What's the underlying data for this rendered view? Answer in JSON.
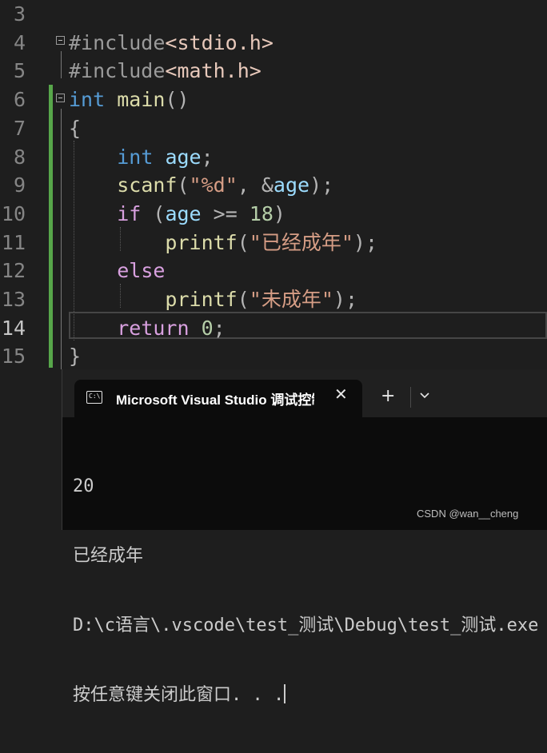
{
  "editor": {
    "lines": [
      {
        "no": "3",
        "tokens": []
      },
      {
        "no": "4",
        "tokens": [
          {
            "t": "#include",
            "c": "pre"
          },
          {
            "t": "<stdio.h>",
            "c": "inc"
          }
        ]
      },
      {
        "no": "5",
        "tokens": [
          {
            "t": "#include",
            "c": "pre"
          },
          {
            "t": "<math.h>",
            "c": "inc"
          }
        ]
      },
      {
        "no": "6",
        "tokens": [
          {
            "t": "int",
            "c": "kw"
          },
          {
            "t": " ",
            "c": ""
          },
          {
            "t": "main",
            "c": "fn"
          },
          {
            "t": "()",
            "c": "punct"
          }
        ]
      },
      {
        "no": "7",
        "tokens": [
          {
            "t": "{",
            "c": "punct"
          }
        ]
      },
      {
        "no": "8",
        "tokens": [
          {
            "t": "    ",
            "c": ""
          },
          {
            "t": "int",
            "c": "kw"
          },
          {
            "t": " ",
            "c": ""
          },
          {
            "t": "age",
            "c": "var"
          },
          {
            "t": ";",
            "c": "punct"
          }
        ]
      },
      {
        "no": "9",
        "tokens": [
          {
            "t": "    ",
            "c": ""
          },
          {
            "t": "scanf",
            "c": "fn"
          },
          {
            "t": "(",
            "c": "punct"
          },
          {
            "t": "\"%d\"",
            "c": "str"
          },
          {
            "t": ", &",
            "c": "punct"
          },
          {
            "t": "age",
            "c": "var"
          },
          {
            "t": ");",
            "c": "punct"
          }
        ]
      },
      {
        "no": "10",
        "tokens": [
          {
            "t": "    ",
            "c": ""
          },
          {
            "t": "if",
            "c": "ctl"
          },
          {
            "t": " (",
            "c": "punct"
          },
          {
            "t": "age",
            "c": "var"
          },
          {
            "t": " >= ",
            "c": "punct"
          },
          {
            "t": "18",
            "c": "num"
          },
          {
            "t": ")",
            "c": "punct"
          }
        ]
      },
      {
        "no": "11",
        "tokens": [
          {
            "t": "        ",
            "c": ""
          },
          {
            "t": "printf",
            "c": "fn"
          },
          {
            "t": "(",
            "c": "punct"
          },
          {
            "t": "\"已经成年\"",
            "c": "str"
          },
          {
            "t": ");",
            "c": "punct"
          }
        ]
      },
      {
        "no": "12",
        "tokens": [
          {
            "t": "    ",
            "c": ""
          },
          {
            "t": "else",
            "c": "ctl"
          }
        ]
      },
      {
        "no": "13",
        "tokens": [
          {
            "t": "        ",
            "c": ""
          },
          {
            "t": "printf",
            "c": "fn"
          },
          {
            "t": "(",
            "c": "punct"
          },
          {
            "t": "\"未成年\"",
            "c": "str"
          },
          {
            "t": ");",
            "c": "punct"
          }
        ]
      },
      {
        "no": "14",
        "tokens": [
          {
            "t": "    ",
            "c": ""
          },
          {
            "t": "return",
            "c": "ctl"
          },
          {
            "t": " ",
            "c": ""
          },
          {
            "t": "0",
            "c": "num"
          },
          {
            "t": ";",
            "c": "punct"
          }
        ]
      },
      {
        "no": "15",
        "tokens": [
          {
            "t": "}",
            "c": "punct"
          }
        ]
      }
    ],
    "active_line": "14",
    "colors": {
      "background": "#1e1e1e",
      "keyword": "#569cd6",
      "control": "#d8a0df",
      "function": "#dcdcaa",
      "variable": "#9cdcfe",
      "string": "#d69d85",
      "number": "#b5cea8",
      "change_bar": "#57a64a"
    }
  },
  "terminal": {
    "tab_icon": "console-window-icon",
    "tab_title": "Microsoft Visual Studio 调试控制台",
    "close_icon": "close-icon",
    "new_tab_icon": "plus-icon",
    "dropdown_icon": "chevron-down-icon",
    "output": [
      "20",
      "已经成年",
      "D:\\c语言\\.vscode\\test_测试\\Debug\\test_测试.exe",
      "按任意键关闭此窗口. . ."
    ]
  },
  "watermark": "CSDN @wan__cheng"
}
